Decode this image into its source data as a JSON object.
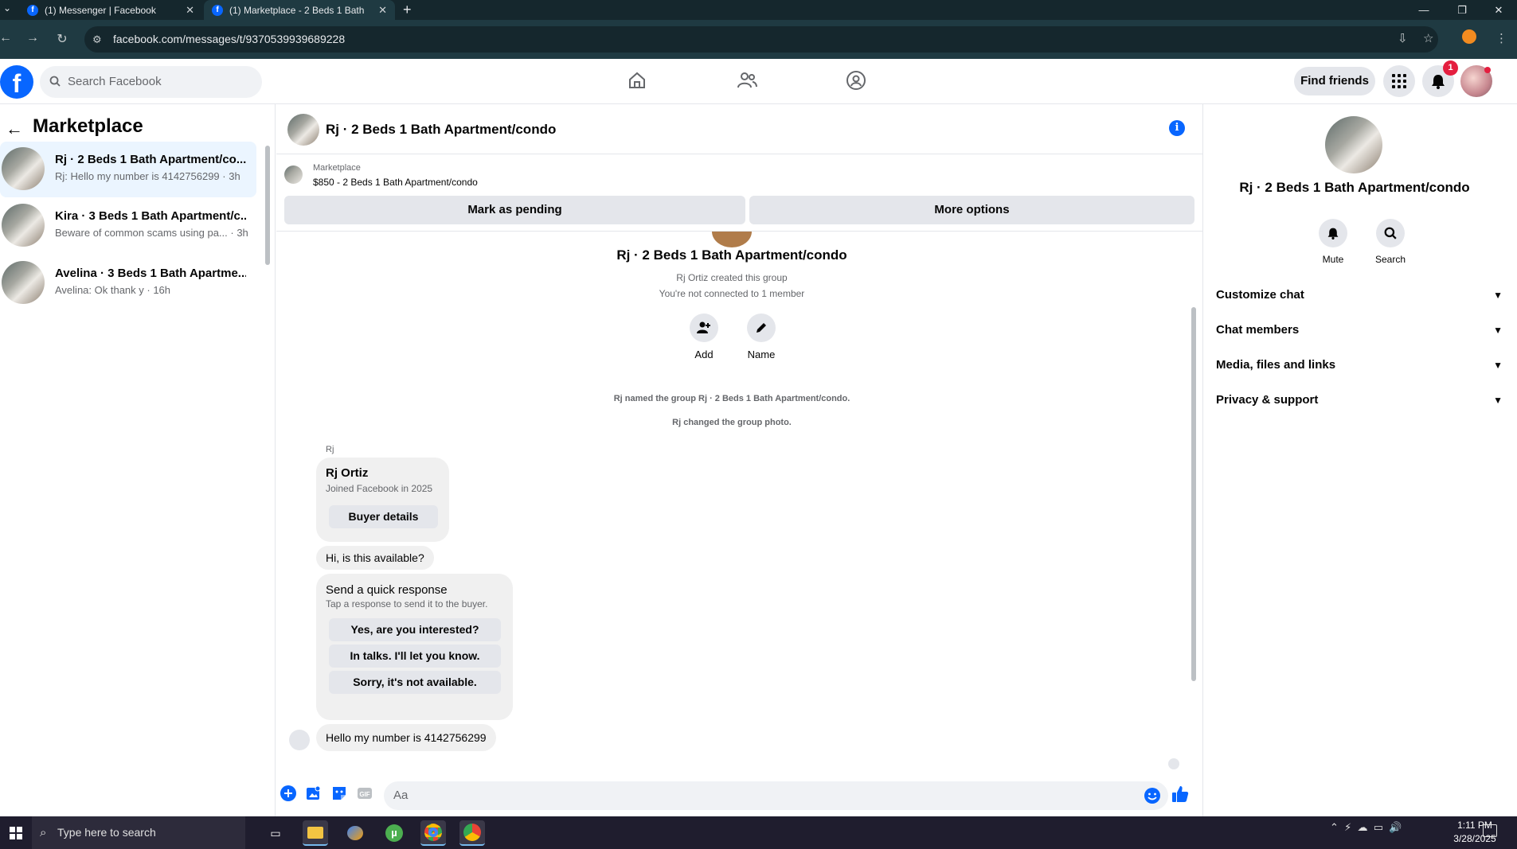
{
  "browser": {
    "tabs": [
      {
        "title": "(1) Messenger | Facebook"
      },
      {
        "title": "(1) Marketplace - 2 Beds 1 Bath"
      }
    ],
    "new_tab": "+",
    "url": "facebook.com/messages/t/9370539939689228"
  },
  "header": {
    "search_placeholder": "Search Facebook",
    "find_friends": "Find friends",
    "notification_count": "1"
  },
  "sidebar": {
    "title": "Marketplace",
    "conversations": [
      {
        "name": "Rj · 2 Beds 1 Bath Apartment/co...",
        "preview": "Rj: Hello my number is 4142756299 · 3h",
        "selected": true
      },
      {
        "name": "Kira · 3 Beds 1 Bath Apartment/c...",
        "preview": "Beware of common scams using pa... · 3h",
        "selected": false
      },
      {
        "name": "Avelina · 3 Beds 1 Bath Apartme...",
        "preview": "Avelina: Ok thank y · 16h",
        "selected": false
      }
    ]
  },
  "chat": {
    "title": "Rj · 2 Beds 1 Bath Apartment/condo",
    "marketplace_label": "Marketplace",
    "listing": "$850 - 2 Beds 1 Bath Apartment/condo",
    "mark_pending": "Mark as pending",
    "more_options": "More options",
    "group_name": "Rj · 2 Beds 1 Bath Apartment/condo",
    "created": "Rj Ortiz created this group",
    "not_connected": "You're not connected to 1 member",
    "add_label": "Add",
    "name_label": "Name",
    "event_named": "Rj named the group Rj · 2 Beds 1 Bath Apartment/condo.",
    "event_photo": "Rj changed the group photo.",
    "sender": "Rj",
    "profile_card": {
      "name": "Rj Ortiz",
      "joined": "Joined Facebook in 2025",
      "button": "Buyer details"
    },
    "msg_available": "Hi, is this available?",
    "quick": {
      "heading": "Send a quick response",
      "sub": "Tap a response to send it to the buyer.",
      "options": [
        "Yes, are you interested?",
        "In talks. I'll let you know.",
        "Sorry, it's not available."
      ]
    },
    "msg_last": "Hello my number is 4142756299",
    "composer_placeholder": "Aa"
  },
  "details": {
    "title": "Rj · 2 Beds 1 Bath Apartment/condo",
    "mute": "Mute",
    "search": "Search",
    "sections": [
      "Customize chat",
      "Chat members",
      "Media, files and links",
      "Privacy & support"
    ]
  },
  "taskbar": {
    "search": "Type here to search",
    "time": "1:11 PM",
    "date": "3/28/2025"
  },
  "colors": {
    "accent": "#0866ff",
    "badge": "#e41e3f",
    "selected_row": "#ebf5ff"
  }
}
